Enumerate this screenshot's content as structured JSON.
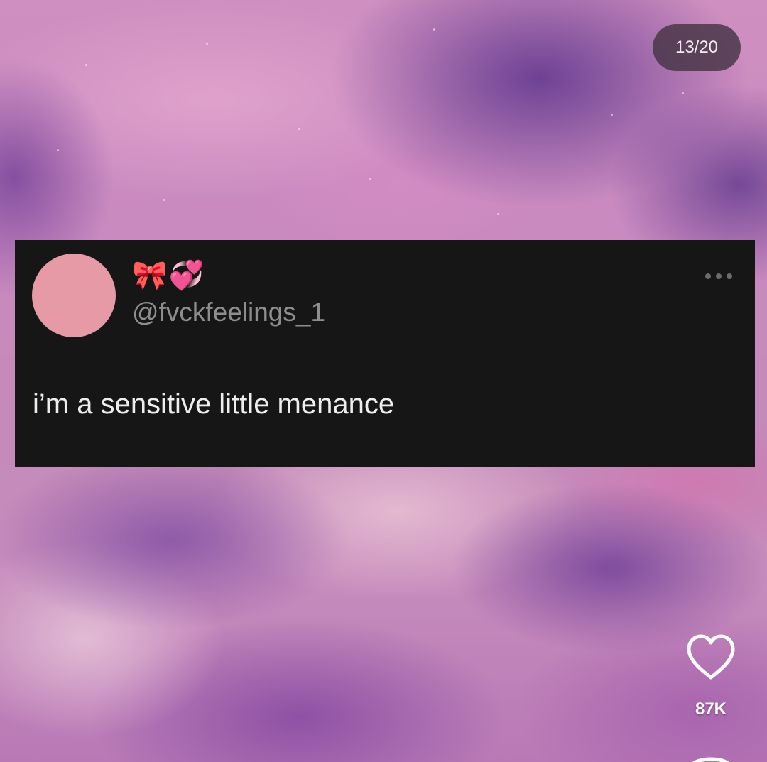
{
  "counter": {
    "label": "13/20"
  },
  "tweet": {
    "display_name": "🎀💞",
    "handle": "@fvckfeelings_1",
    "text": "i’m a sensitive little menance",
    "avatar_color": "#e59aa6",
    "card_background": "#161616"
  },
  "actions": {
    "like_icon": "heart-outline-icon",
    "like_count": "87K"
  }
}
